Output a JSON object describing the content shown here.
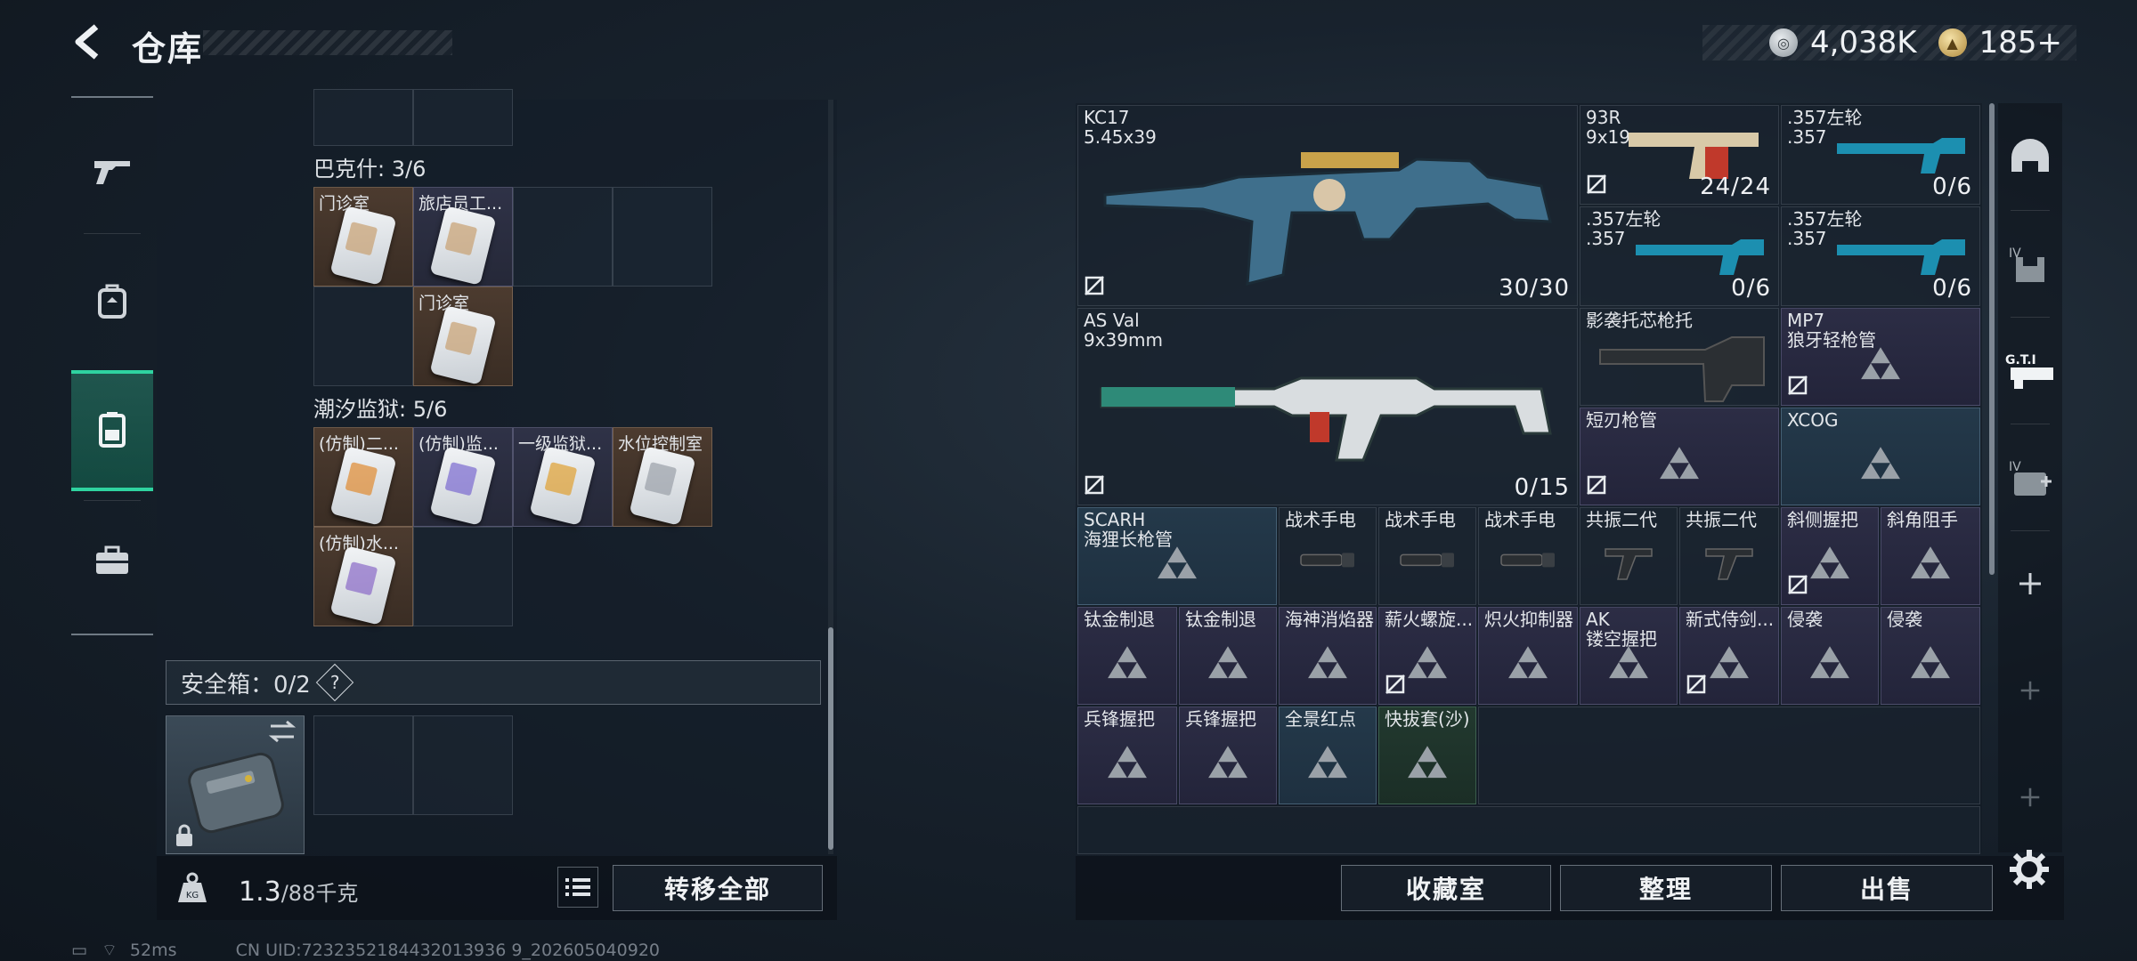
{
  "header": {
    "title": "仓库",
    "currencies": [
      {
        "icon": "silver-coin-icon",
        "value": "4,038K"
      },
      {
        "icon": "gold-coin-icon",
        "value": "185+"
      }
    ]
  },
  "left_nav": [
    {
      "name": "weapons-tab",
      "icon": "gun-icon"
    },
    {
      "name": "backpack-tab",
      "icon": "backpack-icon"
    },
    {
      "name": "keycard-tab",
      "icon": "keycard-icon",
      "active": true
    },
    {
      "name": "briefcase-tab",
      "icon": "briefcase-icon"
    }
  ],
  "storage": {
    "sections": [
      {
        "title": "巴克什: 3/6",
        "items": [
          {
            "label": "门诊室",
            "color": "brown",
            "accent": "#c8a070"
          },
          {
            "label": "旅店员工...",
            "color": "violet",
            "accent": "#c8a070"
          },
          {
            "label": "门诊室",
            "color": "brown",
            "accent": "#c8a070"
          }
        ]
      },
      {
        "title": "潮汐监狱: 5/6",
        "items": [
          {
            "label": "(仿制)二...",
            "color": "brown",
            "accent": "#e08a30"
          },
          {
            "label": "(仿制)监...",
            "color": "violet",
            "accent": "#7a6ad0"
          },
          {
            "label": "一级监狱...",
            "color": "violet",
            "accent": "#e0a030"
          },
          {
            "label": "水位控制室",
            "color": "brown",
            "accent": "#9aa0a8"
          },
          {
            "label": "(仿制)水...",
            "color": "brown",
            "accent": "#8a6ac8"
          }
        ]
      }
    ],
    "safebox": {
      "label": "安全箱：0/2",
      "help": "?"
    },
    "weight": {
      "current": "1.3",
      "max": "/88千克"
    },
    "transfer_all": "转移全部"
  },
  "stash": {
    "weapons": [
      {
        "name": "KC17",
        "ammo": "5.45x39",
        "count": "30/30"
      },
      {
        "name": "93R",
        "ammo": "9x19mm",
        "count": "24/24"
      },
      {
        "name": ".357左轮",
        "ammo": ".357",
        "count": "0/6"
      },
      {
        "name": ".357左轮",
        "ammo": ".357",
        "count": "0/6"
      },
      {
        "name": ".357左轮",
        "ammo": ".357",
        "count": "0/6"
      },
      {
        "name": "AS Val",
        "ammo": "9x39mm",
        "count": "0/15"
      }
    ],
    "parts": [
      {
        "name": "影袭托芯枪托",
        "sub": ""
      },
      {
        "name": "MP7",
        "sub": "狼牙轻枪管"
      },
      {
        "name": "短刃枪管",
        "sub": ""
      },
      {
        "name": "XCOG",
        "sub": ""
      },
      {
        "name": "SCARH",
        "sub": "海狸长枪管"
      },
      {
        "name": "战术手电",
        "sub": ""
      },
      {
        "name": "战术手电",
        "sub": ""
      },
      {
        "name": "战术手电",
        "sub": ""
      },
      {
        "name": "共振二代",
        "sub": ""
      },
      {
        "name": "共振二代",
        "sub": ""
      },
      {
        "name": "斜侧握把",
        "sub": ""
      },
      {
        "name": "斜角阻手",
        "sub": ""
      },
      {
        "name": "钛金制退",
        "sub": ""
      },
      {
        "name": "钛金制退",
        "sub": ""
      },
      {
        "name": "海神消焰器",
        "sub": ""
      },
      {
        "name": "薪火螺旋...",
        "sub": ""
      },
      {
        "name": "炽火抑制器",
        "sub": ""
      },
      {
        "name": "AK",
        "sub": "镂空握把"
      },
      {
        "name": "新式侍剑...",
        "sub": ""
      },
      {
        "name": "侵袭",
        "sub": ""
      },
      {
        "name": "侵袭",
        "sub": ""
      },
      {
        "name": "兵锋握把",
        "sub": ""
      },
      {
        "name": "兵锋握把",
        "sub": ""
      },
      {
        "name": "全景红点",
        "sub": ""
      },
      {
        "name": "快拔套(沙)",
        "sub": ""
      }
    ],
    "buttons": {
      "collection": "收藏室",
      "sort": "整理",
      "sell": "出售"
    }
  },
  "side_tabs": [
    {
      "name": "helmet-tab",
      "icon": "helmet-icon"
    },
    {
      "name": "vest-tab",
      "icon": "vest-icon",
      "label": "IV"
    },
    {
      "name": "gti-tab",
      "icon": "gti-icon",
      "label": "G.T.I"
    },
    {
      "name": "medkit-tab",
      "icon": "medkit-icon",
      "label": "IV"
    },
    {
      "name": "add-tab-1",
      "icon": "plus-icon"
    },
    {
      "name": "add-tab-2",
      "icon": "plus-icon"
    },
    {
      "name": "add-tab-3",
      "icon": "plus-icon"
    }
  ],
  "status": {
    "ping": "52ms",
    "uid": "CN UID:7232352184432013936 9_202605040920"
  }
}
